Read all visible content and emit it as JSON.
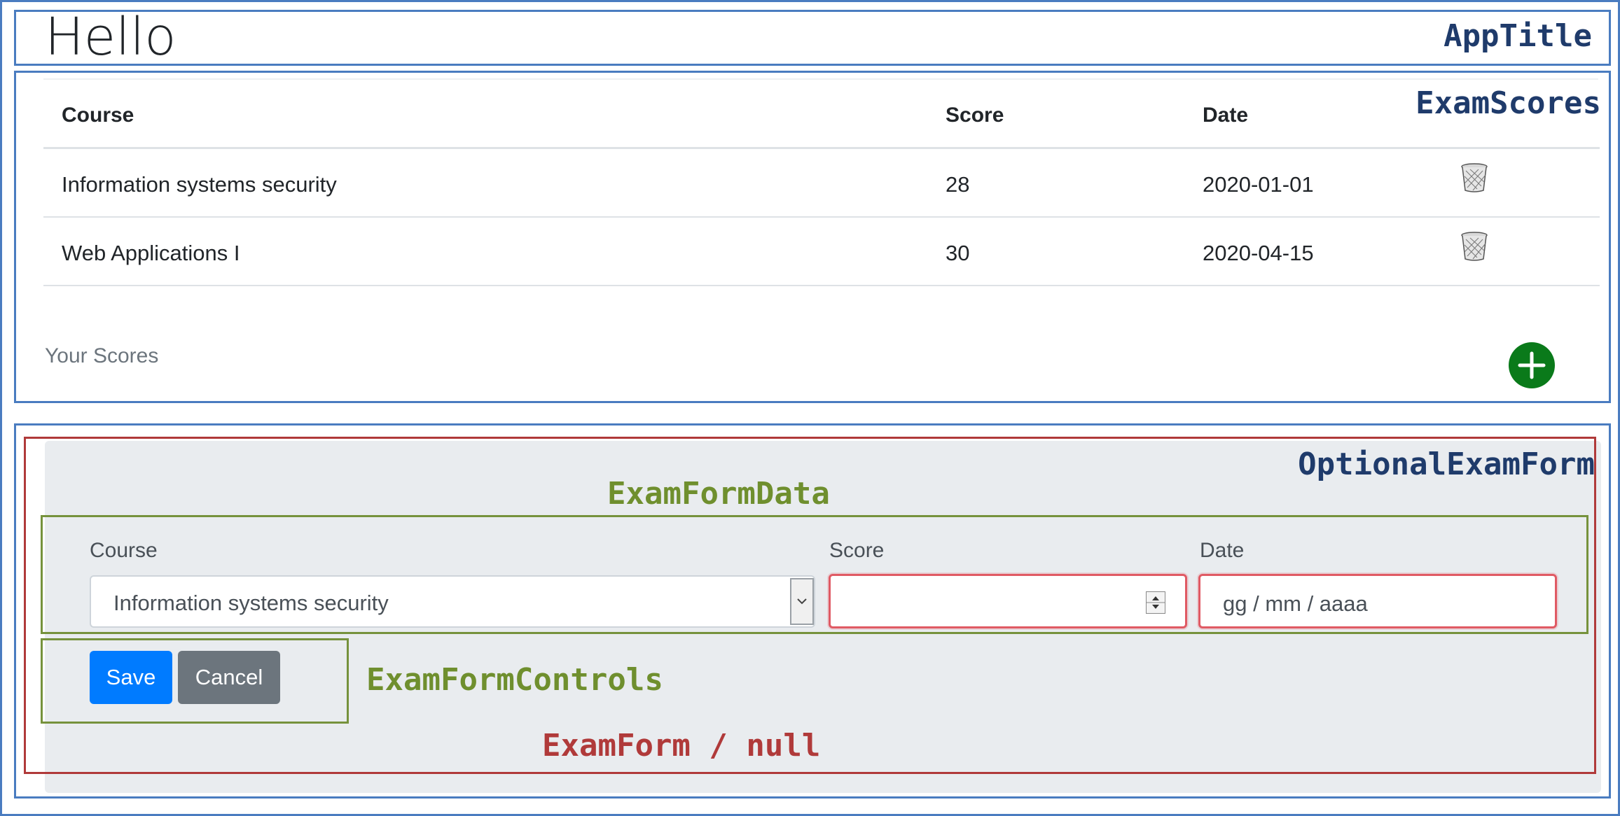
{
  "app": {
    "title": "Hello"
  },
  "annotations": {
    "app_title": "AppTitle",
    "exam_scores": "ExamScores",
    "optional_exam_form": "OptionalExamForm",
    "exam_form_data": "ExamFormData",
    "exam_form_controls": "ExamFormControls",
    "exam_form_null": "ExamForm / null"
  },
  "table": {
    "headers": [
      "Course",
      "Score",
      "Date"
    ],
    "rows": [
      {
        "course": "Information systems security",
        "score": "28",
        "date": "2020-01-01",
        "action_icon": "trash-icon"
      },
      {
        "course": "Web Applications I",
        "score": "30",
        "date": "2020-04-15",
        "action_icon": "trash-icon"
      }
    ],
    "caption": "Your Scores",
    "add_icon": "plus-icon"
  },
  "form": {
    "course_label": "Course",
    "course_value": "Information systems security",
    "score_label": "Score",
    "score_value": "",
    "date_label": "Date",
    "date_placeholder": "gg / mm / aaaa",
    "save_label": "Save",
    "cancel_label": "Cancel"
  },
  "colors": {
    "frame_blue": "#4a7cc0",
    "annotation_blue": "#1f3b6b",
    "annotation_green": "#6f8f2e",
    "annotation_red": "#b03a3a",
    "add_button_green": "#0a7a1a",
    "primary": "#007bff",
    "secondary": "#6c757d",
    "invalid_border": "#e05a64"
  }
}
